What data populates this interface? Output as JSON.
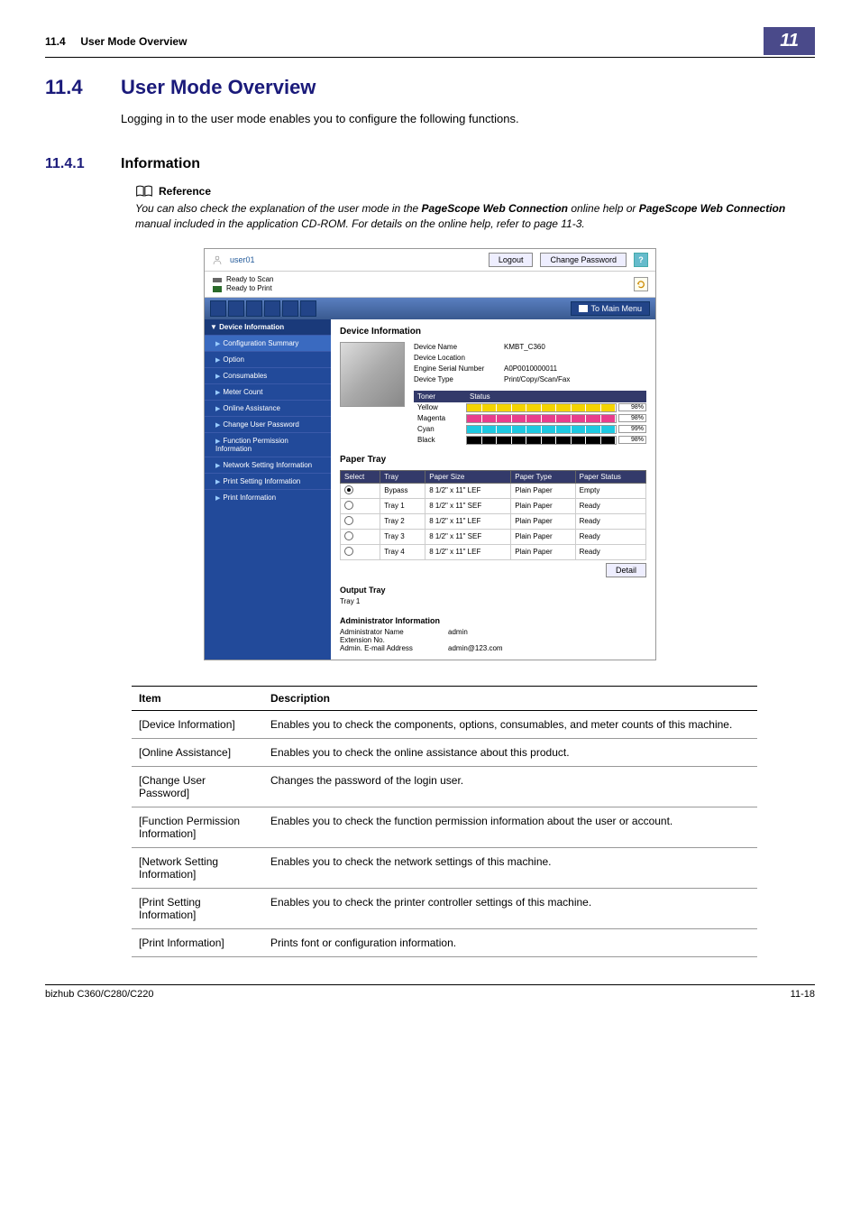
{
  "page_header": {
    "section": "11.4",
    "title": "User Mode Overview",
    "chapter_tab": "11"
  },
  "section": {
    "number": "11.4",
    "title": "User Mode Overview",
    "intro": "Logging in to the user mode enables you to configure the following functions."
  },
  "subsection": {
    "number": "11.4.1",
    "title": "Information"
  },
  "reference": {
    "heading": "Reference",
    "text_pre": "You can also check the explanation of the user mode in the ",
    "bold1": "PageScope Web Connection",
    "text_mid": " online help or ",
    "bold2": "PageScope Web Connection",
    "text_post": " manual included in the application CD-ROM. For details on the online help, refer to page 11-3."
  },
  "screenshot": {
    "user": "user01",
    "logout": "Logout",
    "change_password": "Change Password",
    "help": "?",
    "status_scan": "Ready to Scan",
    "status_print": "Ready to Print",
    "main_menu": "To Main Menu",
    "sidebar_header": "Device Information",
    "sidebar": [
      "Configuration Summary",
      "Option",
      "Consumables",
      "Meter Count",
      "Online Assistance",
      "Change User Password",
      "Function Permission Information",
      "Network Setting Information",
      "Print Setting Information",
      "Print Information"
    ],
    "content_title": "Device Information",
    "device": {
      "name_label": "Device Name",
      "name_value": "KMBT_C360",
      "location_label": "Device Location",
      "location_value": "",
      "serial_label": "Engine Serial Number",
      "serial_value": "A0P0010000011",
      "type_label": "Device Type",
      "type_value": "Print/Copy/Scan/Fax"
    },
    "toner_header": {
      "col1": "Toner",
      "col2": "Status"
    },
    "toner": [
      {
        "name": "Yellow",
        "color": "#f5d400",
        "pct": "98%"
      },
      {
        "name": "Magenta",
        "color": "#e83e8c",
        "pct": "98%"
      },
      {
        "name": "Cyan",
        "color": "#1ec8e0",
        "pct": "99%"
      },
      {
        "name": "Black",
        "color": "#000000",
        "pct": "98%"
      }
    ],
    "paper_tray_title": "Paper Tray",
    "tray_headers": {
      "select": "Select",
      "tray": "Tray",
      "size": "Paper Size",
      "type": "Paper Type",
      "status": "Paper Status"
    },
    "trays": [
      {
        "selected": true,
        "tray": "Bypass",
        "size": "8 1/2\" x 11\" LEF",
        "type": "Plain Paper",
        "status": "Empty"
      },
      {
        "selected": false,
        "tray": "Tray 1",
        "size": "8 1/2\" x 11\" SEF",
        "type": "Plain Paper",
        "status": "Ready"
      },
      {
        "selected": false,
        "tray": "Tray 2",
        "size": "8 1/2\" x 11\" LEF",
        "type": "Plain Paper",
        "status": "Ready"
      },
      {
        "selected": false,
        "tray": "Tray 3",
        "size": "8 1/2\" x 11\" SEF",
        "type": "Plain Paper",
        "status": "Ready"
      },
      {
        "selected": false,
        "tray": "Tray 4",
        "size": "8 1/2\" x 11\" LEF",
        "type": "Plain Paper",
        "status": "Ready"
      }
    ],
    "detail_btn": "Detail",
    "output_tray_title": "Output Tray",
    "output_tray_value": "Tray 1",
    "admin_title": "Administrator Information",
    "admin": {
      "name_label": "Administrator Name",
      "name_value": "admin",
      "ext_label": "Extension No.",
      "ext_value": "",
      "email_label": "Admin. E-mail Address",
      "email_value": "admin@123.com"
    }
  },
  "desc_table": {
    "headers": {
      "item": "Item",
      "desc": "Description"
    },
    "rows": [
      {
        "item": "[Device Information]",
        "desc": "Enables you to check the components, options, consumables, and meter counts of this machine."
      },
      {
        "item": "[Online Assistance]",
        "desc": "Enables you to check the online assistance about this product."
      },
      {
        "item": "[Change User Password]",
        "desc": "Changes the password of the login user."
      },
      {
        "item": "[Function Permission Information]",
        "desc": "Enables you to check the function permission information about the user or account."
      },
      {
        "item": "[Network Setting Information]",
        "desc": "Enables you to check the network settings of this machine."
      },
      {
        "item": "[Print Setting Information]",
        "desc": "Enables you to check the printer controller settings of this machine."
      },
      {
        "item": "[Print Information]",
        "desc": "Prints font or configuration information."
      }
    ]
  },
  "footer": {
    "left": "bizhub C360/C280/C220",
    "right": "11-18"
  }
}
